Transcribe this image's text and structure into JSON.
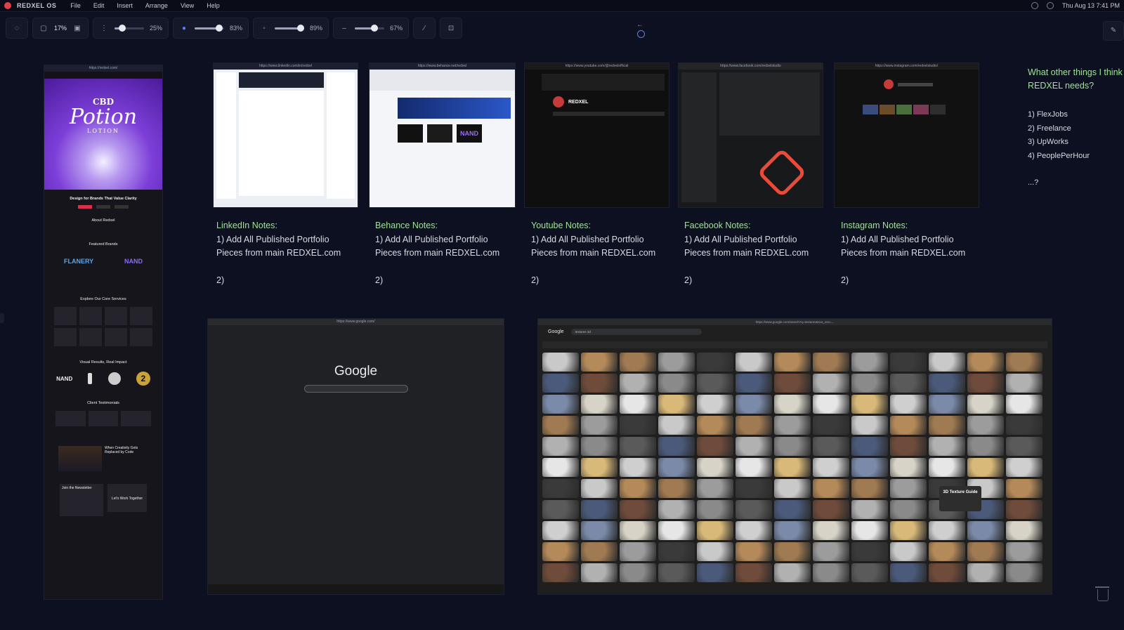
{
  "menubar": {
    "app_name": "REDXEL OS",
    "menus": [
      "File",
      "Edit",
      "Insert",
      "Arrange",
      "View",
      "Help"
    ],
    "datetime": "Thu Aug 13 7:41 PM"
  },
  "toolbar": {
    "zoom": "17%",
    "slider1_value": "25%",
    "slider2_value": "83%",
    "slider3_value": "89%",
    "slider4_value": "67%",
    "slider_levels": [
      0.25,
      0.83,
      0.89,
      0.67
    ]
  },
  "website": {
    "url": "https://redxel.com/",
    "hero_brand_line1": "CBD",
    "hero_brand_line2": "Potion",
    "hero_brand_line3": "LOTION",
    "headline": "Design for Brands That Value Clarity",
    "about": "About Redxel",
    "featured": "Featured Brands",
    "brand1": "FLANERY",
    "brand2": "NAND",
    "services": "Explore Our Core Services",
    "visual": "Visual Results, Real Impact",
    "testimonials": "Client Testimonials",
    "creativity": "When Creativity Gets Replaced by Code",
    "newsletter": "Join the Newsletter",
    "work_together": "Let's Work Together",
    "results_nand": "NAND",
    "results_two": "2"
  },
  "shots": {
    "linkedin_url": "https://www.linkedin.com/in/redxel",
    "behance_url": "https://www.behance.net/redxel",
    "youtube_url": "https://www.youtube.com/@redxelofficial",
    "facebook_url": "https://www.facebook.com/redxelstudio",
    "instagram_url": "https://www.instagram.com/redxelstudio/",
    "google_url": "https://www.google.com/",
    "google_logo": "Google",
    "images_url": "https://www.google.com/search?q=textures&sca_esv=...",
    "images_logo": "Google",
    "images_query": "textures 3d",
    "youtube_channel": "REDXEL",
    "behance_brand": "NAND",
    "texture_guide": "3D Texture Guide"
  },
  "notes": [
    {
      "title": "LinkedIn Notes:",
      "line1": "1) Add All Published Portfolio",
      "line2": "Pieces from main REDXEL.com",
      "line3": "2)"
    },
    {
      "title": "Behance Notes:",
      "line1": "1) Add All Published Portfolio",
      "line2": "Pieces from main REDXEL.com",
      "line3": "2)"
    },
    {
      "title": "Youtube Notes:",
      "line1": "1) Add All Published Portfolio",
      "line2": "Pieces from main REDXEL.com",
      "line3": "2)"
    },
    {
      "title": "Facebook Notes:",
      "line1": "1) Add All Published Portfolio",
      "line2": "Pieces from main REDXEL.com",
      "line3": "2)"
    },
    {
      "title": "Instagram Notes:",
      "line1": "1) Add All Published Portfolio",
      "line2": "Pieces from main REDXEL.com",
      "line3": "2)"
    }
  ],
  "side": {
    "question": "What other things I think REDXEL needs?",
    "items": [
      "1) FlexJobs",
      "2) Freelance",
      "3) UpWorks",
      "4) PeoplePerHour"
    ],
    "more": "...?"
  }
}
